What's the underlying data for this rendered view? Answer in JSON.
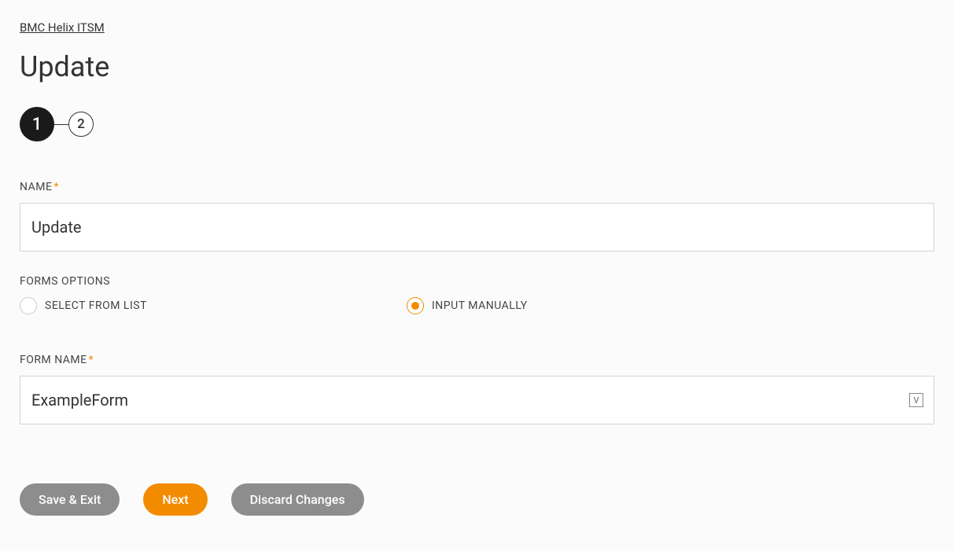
{
  "breadcrumb": "BMC Helix ITSM",
  "page_title": "Update",
  "stepper": {
    "step1": "1",
    "step2": "2"
  },
  "name_field": {
    "label": "NAME",
    "required_marker": "*",
    "value": "Update"
  },
  "forms_options": {
    "label": "FORMS OPTIONS",
    "select_from_list": "SELECT FROM LIST",
    "input_manually": "INPUT MANUALLY"
  },
  "form_name_field": {
    "label": "FORM NAME",
    "required_marker": "*",
    "value": "ExampleForm",
    "icon_letter": "V"
  },
  "buttons": {
    "save_exit": "Save & Exit",
    "next": "Next",
    "discard": "Discard Changes"
  }
}
